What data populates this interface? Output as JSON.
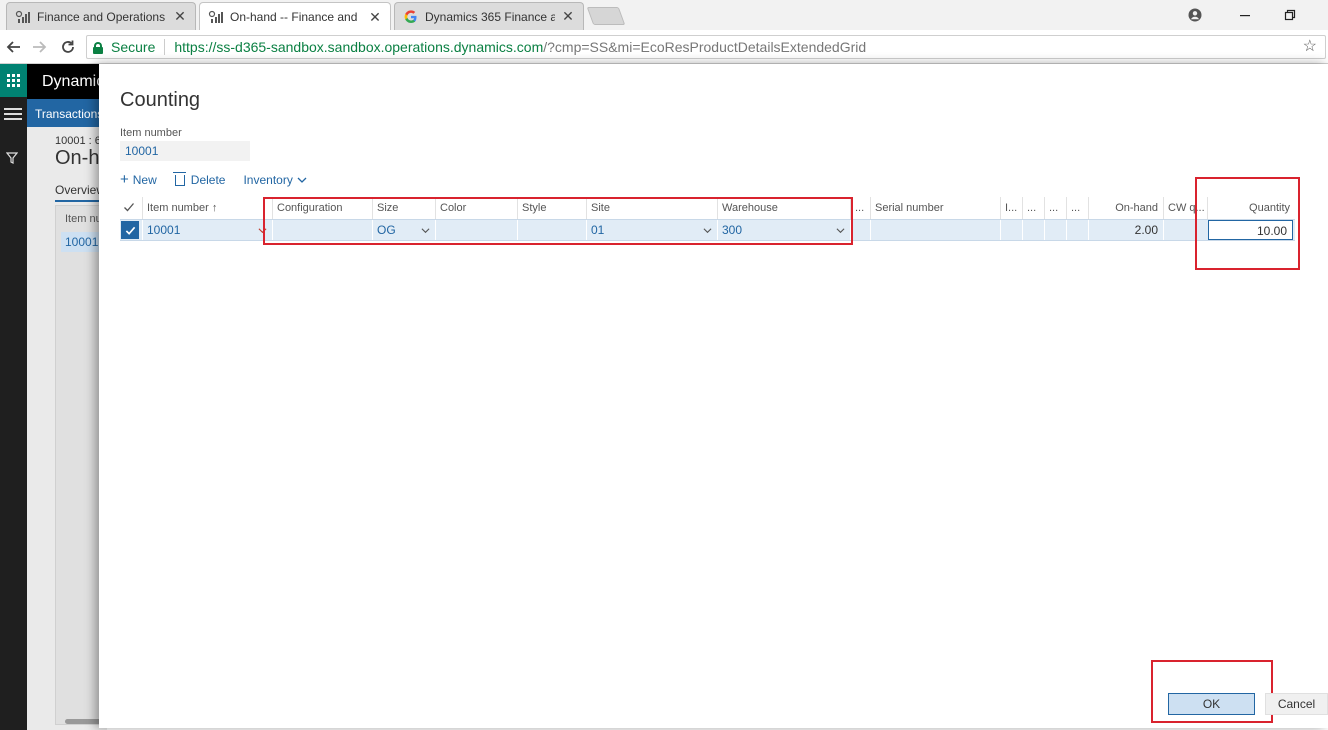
{
  "browser": {
    "tabs": [
      {
        "label": "Finance and Operations",
        "icon": "d365-icon",
        "active": false
      },
      {
        "label": "On-hand -- Finance and",
        "icon": "d365-icon",
        "active": true
      },
      {
        "label": "Dynamics 365 Finance ar",
        "icon": "google-icon",
        "active": false
      }
    ],
    "secure_label": "Secure",
    "url_host": "https://ss-d365-sandbox.sandbox.operations.dynamics.com",
    "url_path": "/?cmp=SS&mi=EcoResProductDetailsExtendedGrid"
  },
  "background_app": {
    "app_title": "Dynamics",
    "action_tab": "Transactions",
    "breadcrumb": "10001 : 6",
    "page_title": "On-h",
    "section_tab": "Overview",
    "column_header": "Item nu",
    "cell_value": "10001"
  },
  "dialog": {
    "title": "Counting",
    "item_number_label": "Item number",
    "item_number_value": "10001",
    "toolbar": {
      "new_label": "New",
      "delete_label": "Delete",
      "inventory_label": "Inventory"
    },
    "columns": {
      "item_number": "Item number",
      "item_number_sort": "↑",
      "configuration": "Configuration",
      "size": "Size",
      "color": "Color",
      "style": "Style",
      "site": "Site",
      "warehouse": "Warehouse",
      "ellipsis1": "...",
      "serial_number": "Serial number",
      "col_l": "I...",
      "ellipsis2": "...",
      "ellipsis3": "...",
      "ellipsis4": "...",
      "on_hand": "On-hand",
      "cw": "CW q...",
      "quantity": "Quantity"
    },
    "row": {
      "item_number": "10001",
      "configuration": "",
      "size": "OG",
      "color": "",
      "style": "",
      "site": "01",
      "warehouse": "300",
      "serial_number": "",
      "on_hand": "2.00",
      "cw": "",
      "quantity": "10.00"
    },
    "ok_label": "OK",
    "cancel_label": "Cancel"
  },
  "colors": {
    "accent": "#2266a3",
    "highlight_box": "#d9232e",
    "secure_green": "#0b8043",
    "teal": "#008272"
  }
}
